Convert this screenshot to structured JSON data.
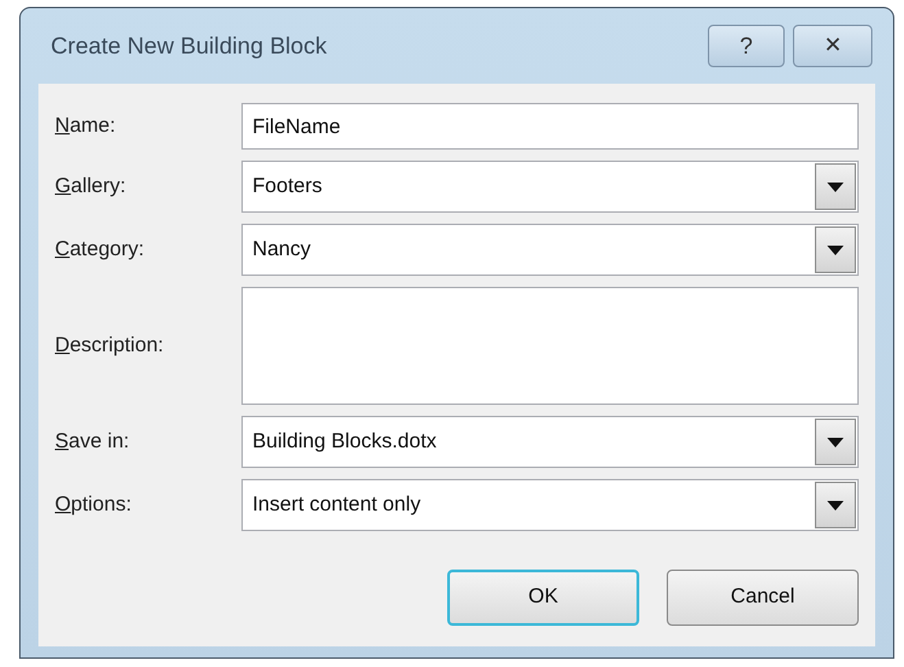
{
  "window": {
    "title": "Create New Building Block",
    "help": "?",
    "close": "✕"
  },
  "fields": [
    {
      "label": "Name:",
      "mnemonic": true,
      "kind": "text",
      "value": "FileName"
    },
    {
      "label": "Gallery:",
      "mnemonic": true,
      "kind": "dropdown",
      "value": "Footers"
    },
    {
      "label": "Category:",
      "mnemonic": true,
      "kind": "dropdown",
      "value": "Nancy"
    },
    {
      "label": "Description:",
      "mnemonic": true,
      "kind": "textarea"
    },
    {
      "label": "Save in:",
      "mnemonic": true,
      "kind": "dropdown",
      "value": "Building Blocks.dotx"
    },
    {
      "label": "Options:",
      "mnemonic": true,
      "kind": "dropdown",
      "value": "Insert content only"
    }
  ],
  "buttons": [
    {
      "label": "OK",
      "default": true
    },
    {
      "label": "Cancel",
      "default": false
    }
  ]
}
